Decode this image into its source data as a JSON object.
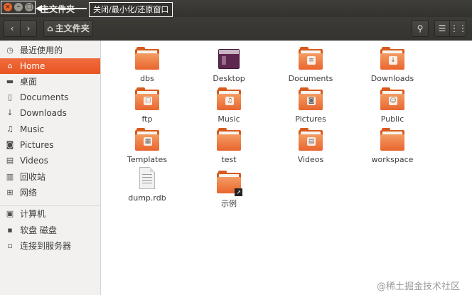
{
  "window": {
    "title": "主文件夹",
    "controls": {
      "close_glyph": "×",
      "minimize_glyph": "–",
      "maximize_glyph": "□"
    }
  },
  "annotation": {
    "text": "关闭/最小化/还原窗口"
  },
  "toolbar": {
    "back_glyph": "‹",
    "forward_glyph": "›",
    "breadcrumb": "主文件夹",
    "home_glyph": "⌂",
    "search_glyph": "⚲",
    "list_view_glyph": "☰",
    "menu_glyph": "⋮⋮"
  },
  "sidebar": {
    "items": [
      {
        "label": "最近使用的",
        "icon": "clock-icon",
        "glyph": "◷"
      },
      {
        "label": "Home",
        "icon": "home-icon",
        "glyph": "⌂",
        "active": true
      },
      {
        "label": "桌面",
        "icon": "folder-icon",
        "glyph": "▬"
      },
      {
        "label": "Documents",
        "icon": "document-icon",
        "glyph": "▯"
      },
      {
        "label": "Downloads",
        "icon": "download-icon",
        "glyph": "↓"
      },
      {
        "label": "Music",
        "icon": "music-icon",
        "glyph": "♫"
      },
      {
        "label": "Pictures",
        "icon": "camera-icon",
        "glyph": "◙"
      },
      {
        "label": "Videos",
        "icon": "film-icon",
        "glyph": "▤"
      },
      {
        "label": "回收站",
        "icon": "trash-icon",
        "glyph": "▥"
      },
      {
        "label": "网络",
        "icon": "network-icon",
        "glyph": "⊞"
      },
      {
        "label": "计算机",
        "icon": "computer-icon",
        "glyph": "▣"
      },
      {
        "label": "软盘 磁盘",
        "icon": "floppy-icon",
        "glyph": "▪"
      },
      {
        "label": "连接到服务器",
        "icon": "server-icon",
        "glyph": "▫"
      }
    ]
  },
  "files": [
    {
      "name": "dbs",
      "type": "folder"
    },
    {
      "name": "Desktop",
      "type": "desktop"
    },
    {
      "name": "Documents",
      "type": "folder",
      "emblem": "≡"
    },
    {
      "name": "Downloads",
      "type": "folder",
      "emblem": "↓"
    },
    {
      "name": "ftp",
      "type": "folder",
      "emblem": "☐"
    },
    {
      "name": "Music",
      "type": "folder",
      "emblem": "♫"
    },
    {
      "name": "Pictures",
      "type": "folder",
      "emblem": "◙"
    },
    {
      "name": "Public",
      "type": "folder",
      "emblem": "☺"
    },
    {
      "name": "Templates",
      "type": "folder",
      "emblem": "▦"
    },
    {
      "name": "test",
      "type": "folder"
    },
    {
      "name": "Videos",
      "type": "folder",
      "emblem": "▤"
    },
    {
      "name": "workspace",
      "type": "folder"
    },
    {
      "name": "dump.rdb",
      "type": "document"
    },
    {
      "name": "示例",
      "type": "folder-link",
      "emblem": "↗"
    }
  ],
  "watermark": {
    "text": "@稀土掘金技术社区"
  },
  "colors": {
    "accent": "#e95420",
    "folder": "#e9652e",
    "titlebar": "#3c3b37"
  }
}
